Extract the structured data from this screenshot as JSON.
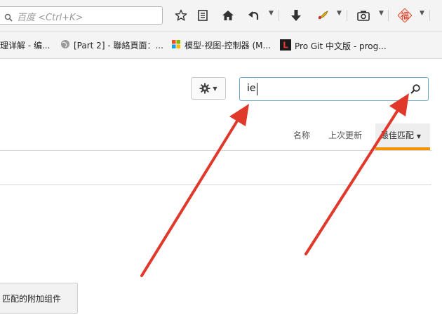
{
  "toolbar": {
    "search_engine_placeholder": "百度 <Ctrl+K>",
    "icons": [
      "search-engine-icon",
      "star-icon",
      "reading-list-icon",
      "home-icon",
      "back-icon",
      "download-icon",
      "extension-icon",
      "screenshot-icon",
      "fu-icon"
    ]
  },
  "bookmarks": [
    {
      "label": "理详解 - 编...",
      "icon": "none"
    },
    {
      "label": "[Part 2] - 聯絡頁面：...",
      "icon": "globe-icon"
    },
    {
      "label": "模型-视图-控制器 (M...",
      "icon": "windows-icon"
    },
    {
      "label": "Pro Git 中文版 - prog...",
      "icon": "red-l-icon"
    }
  ],
  "addons": {
    "search_value": "ie",
    "sort": {
      "name_label": "名称",
      "updated_label": "上次更新",
      "best_match_label": "最佳匹配"
    },
    "more_results_label": "匹配的附加组件"
  },
  "colors": {
    "accent_orange": "#f29400",
    "arrow_red": "#e0392b",
    "search_border": "#6fa7c9"
  }
}
